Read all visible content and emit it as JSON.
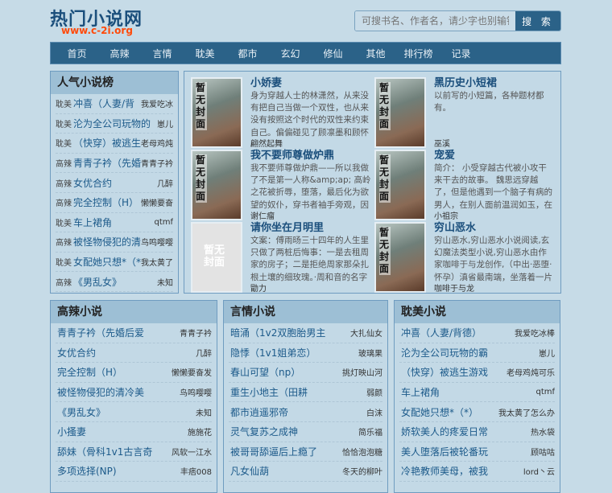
{
  "header": {
    "logo": "热门小说网",
    "url": "www.c-2i.org",
    "search_placeholder": "可搜书名、作者名，请少字也别输错字",
    "search_button": "搜 索"
  },
  "nav": [
    "首页",
    "高辣",
    "言情",
    "耽美",
    "都市",
    "玄幻",
    "修仙",
    "其他",
    "排行榜",
    "记录"
  ],
  "popular": {
    "title": "人气小说榜",
    "items": [
      {
        "cat": "耽美",
        "title": "冲喜（人妻/背",
        "author": "我爱吃冰"
      },
      {
        "cat": "耽美",
        "title": "沦为全公司玩物的",
        "author": "崽儿"
      },
      {
        "cat": "耽美",
        "title": "（快穿）被逃生游",
        "author": "老母鸡炖"
      },
      {
        "cat": "高辣",
        "title": "青青子衿（先婚后",
        "author": "青青子衿"
      },
      {
        "cat": "高辣",
        "title": "女优合约",
        "author": "几醉"
      },
      {
        "cat": "高辣",
        "title": "完全控制（H）",
        "author": "懒懒要奋"
      },
      {
        "cat": "耽美",
        "title": "车上裙角",
        "author": "qtmf"
      },
      {
        "cat": "高辣",
        "title": "被怪物侵犯的清冷",
        "author": "鸟鸣嘤嘤"
      },
      {
        "cat": "耽美",
        "title": "女配她只想*（*）",
        "author": "我太黄了"
      },
      {
        "cat": "高辣",
        "title": "《男乱女》",
        "author": "未知"
      }
    ]
  },
  "cover_text": "暂无封面",
  "featured": [
    {
      "title": "小娇妻",
      "desc": "身为穿越人士的林潇然，从来没有把自己当做一个双性，也从来没有按照这个时代的双性来约束自己。偏偏碰见了顾凛墨和顾怀霖这两个",
      "author": "翩然起舞",
      "blank": false
    },
    {
      "title": "黑历史小短裙",
      "desc": "以前写的小短篇，各种题材都有。",
      "author": "巫溪",
      "blank": false
    },
    {
      "title": "我不要师尊做炉鼎",
      "desc": "我不要师尊做炉鼎——所以我做了不是第一人称&amp;ap; 高岭之花被折辱，堕落，最后化为欲望的奴仆，穿书者袖手旁观，因为他知",
      "author": "谢仁瘤",
      "blank": false
    },
    {
      "title": "宠爱",
      "desc": "简介： 小受穿越古代被小攻干来干去的故事。 魏思远穿越了，但是他遇到一个脑子有病的男人，在别人面前温润如玉，在他面前就是",
      "author": "小祖宗",
      "blank": false
    },
    {
      "title": "请你坐在月明里",
      "desc": "文案：傅雨旸三十四年的人生里只做了两桩后悔事：一是去租周家的房子；二是拒绝周家那朵扎根土壤的细玫瑰。·周和音的名字是阿婆",
      "author": "勖力",
      "blank": true
    },
    {
      "title": "穷山恶水",
      "desc": "穷山恶水,穷山恶水小说阅读,玄幻魔法类型小说,穷山恶水由作家咖啡于与龙创作,（中出·恶堕·怀孕）滇省最南端，坐落着一片为重峦迭",
      "author": "咖啡于与龙",
      "blank": false
    }
  ],
  "sections": [
    {
      "title": "高辣小说",
      "items": [
        {
          "title": "青青子衿（先婚后爱",
          "author": "青青子衿"
        },
        {
          "title": "女优合约",
          "author": "几醉"
        },
        {
          "title": "完全控制（H）",
          "author": "懒懒要奋发"
        },
        {
          "title": "被怪物侵犯的清冷美",
          "author": "鸟鸣嘤嘤"
        },
        {
          "title": "《男乱女》",
          "author": "未知"
        },
        {
          "title": "小搔妻",
          "author": "施施花"
        },
        {
          "title": "舔妹（骨科1v1古言奇",
          "author": "风软一江水"
        },
        {
          "title": "多项选择(NP)",
          "author": "丰痞008"
        }
      ]
    },
    {
      "title": "言情小说",
      "items": [
        {
          "title": "暗涌（1v2双胞胎男主",
          "author": "大扎仙女"
        },
        {
          "title": "隐悸（1v1姐弟恋）",
          "author": "玻璃果"
        },
        {
          "title": "春山可望（np）",
          "author": "挑灯映山河"
        },
        {
          "title": "重生小地主（田耕",
          "author": "弱颜"
        },
        {
          "title": "都市逍遥邪帝",
          "author": "白沫"
        },
        {
          "title": "灵气复苏之成神",
          "author": "简乐福"
        },
        {
          "title": "被哥哥舔逼后上瘾了",
          "author": "恰恰泡泡糖"
        },
        {
          "title": "凡女仙葫",
          "author": "冬天的柳叶"
        }
      ]
    },
    {
      "title": "耽美小说",
      "items": [
        {
          "title": "冲喜（人妻/背德）",
          "author": "我爱吃冰棒"
        },
        {
          "title": "沦为全公司玩物的霸",
          "author": "崽儿"
        },
        {
          "title": "（快穿）被逃生游戏",
          "author": "老母鸡炖可乐"
        },
        {
          "title": "车上裙角",
          "author": "qtmf"
        },
        {
          "title": "女配她只想*（*）",
          "author": "我太黄了怎么办"
        },
        {
          "title": "娇软美人的疼爱日常",
          "author": "热水袋"
        },
        {
          "title": "美人堕落后被轮番玩",
          "author": "顾咕咕"
        },
        {
          "title": "冷艳教师美母，被我",
          "author": "lord丶云"
        }
      ]
    }
  ]
}
